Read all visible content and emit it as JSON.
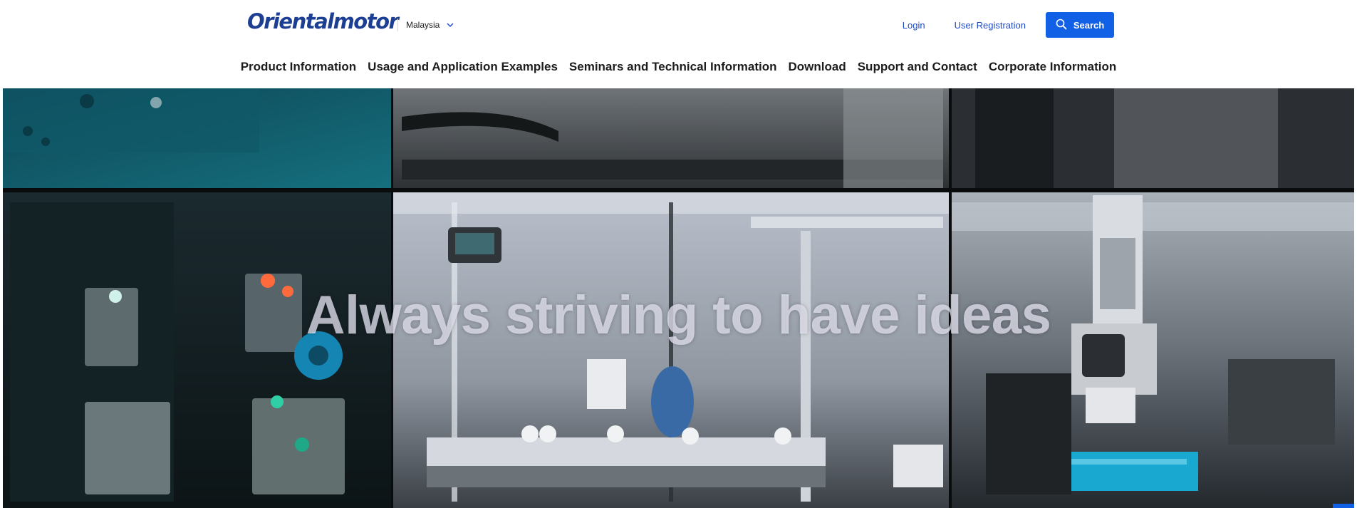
{
  "header": {
    "logo_text": "Orientalmotor",
    "region": "Malaysia",
    "login_label": "Login",
    "register_label": "User Registration",
    "search_label": "Search"
  },
  "nav": {
    "items": [
      {
        "label": "Product Information"
      },
      {
        "label": "Usage and Application Examples"
      },
      {
        "label": "Seminars and Technical Information"
      },
      {
        "label": "Download"
      },
      {
        "label": "Support and Contact"
      },
      {
        "label": "Corporate Information"
      }
    ]
  },
  "hero": {
    "headline": "Always striving to have ideas"
  },
  "colors": {
    "brand": "#1c3f94",
    "accent": "#1160e6",
    "link": "#1c49c8"
  },
  "icons": {
    "search": "search-icon",
    "region_toggle": "chevron-down-icon"
  }
}
